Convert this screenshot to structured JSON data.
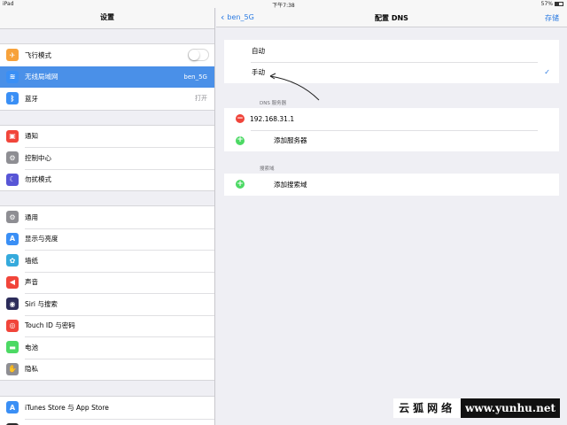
{
  "status": {
    "device": "iPad",
    "time": "下午7:38",
    "battery": "57%"
  },
  "left": {
    "title": "设置",
    "group1": [
      {
        "label": "飞行模式",
        "icon": "airplane-icon",
        "color": "#f7a23b",
        "glyph": "✈",
        "toggle": true
      },
      {
        "label": "无线局域网",
        "icon": "wifi-icon",
        "color": "#3a8ff5",
        "glyph": "≋",
        "value": "ben_5G",
        "selected": true
      },
      {
        "label": "蓝牙",
        "icon": "bluetooth-icon",
        "color": "#3a8ff5",
        "glyph": "ᛒ",
        "value": "打开"
      }
    ],
    "group2": [
      {
        "label": "通知",
        "icon": "notifications-icon",
        "color": "#f1453a",
        "glyph": "▣"
      },
      {
        "label": "控制中心",
        "icon": "control-center-icon",
        "color": "#8e8e93",
        "glyph": "⚙"
      },
      {
        "label": "勿扰模式",
        "icon": "moon-icon",
        "color": "#5856d6",
        "glyph": "☾"
      }
    ],
    "group3": [
      {
        "label": "通用",
        "icon": "general-gear-icon",
        "color": "#8e8e93",
        "glyph": "⚙"
      },
      {
        "label": "显示与亮度",
        "icon": "display-brightness-icon",
        "color": "#3a8ff5",
        "glyph": "A"
      },
      {
        "label": "墙纸",
        "icon": "wallpaper-icon",
        "color": "#35aadc",
        "glyph": "✿"
      },
      {
        "label": "声音",
        "icon": "sound-icon",
        "color": "#f1453a",
        "glyph": "◀"
      },
      {
        "label": "Siri 与搜索",
        "icon": "siri-icon",
        "color": "#2c2c5a",
        "glyph": "◉"
      },
      {
        "label": "Touch ID 与密码",
        "icon": "fingerprint-icon",
        "color": "#f1453a",
        "glyph": "◎"
      },
      {
        "label": "电池",
        "icon": "battery-icon",
        "color": "#4cd964",
        "glyph": "▬"
      },
      {
        "label": "隐私",
        "icon": "privacy-hand-icon",
        "color": "#8e8e93",
        "glyph": "✋"
      }
    ],
    "group4": [
      {
        "label": "iTunes Store 与 App Store",
        "icon": "app-store-icon",
        "color": "#3a8ff5",
        "glyph": "A"
      },
      {
        "label": "Wallet 与 Apple Pay",
        "icon": "wallet-icon",
        "color": "#2b2b2b",
        "glyph": "▤"
      }
    ]
  },
  "right": {
    "back_label": "ben_5G",
    "title": "配置 DNS",
    "save_label": "存储",
    "mode_auto": "自动",
    "mode_manual": "手动",
    "dns_section": "DNS 服务器",
    "dns_server": "192.168.31.1",
    "add_server": "添加服务器",
    "search_section": "搜索域",
    "add_search_domain": "添加搜索域"
  },
  "watermark": {
    "left": "云狐网络",
    "right": "www.yunhu.net"
  }
}
